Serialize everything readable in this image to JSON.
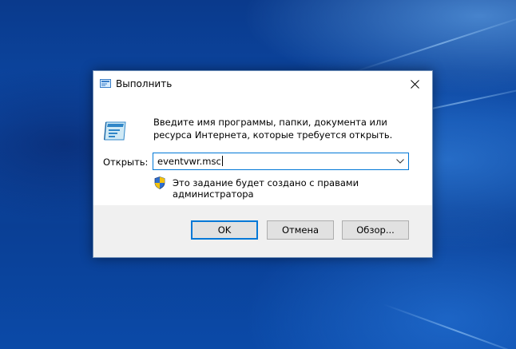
{
  "dialog": {
    "title": "Выполнить",
    "close_glyph": "✕",
    "description": "Введите имя программы, папки, документа или ресурса Интернета, которые требуется открыть.",
    "open_label": "Открыть:",
    "open_value": "eventvwr.msc",
    "admin_note": "Это задание будет создано с правами администратора",
    "buttons": {
      "ok": "OK",
      "cancel": "Отмена",
      "browse": "Обзор..."
    }
  },
  "colors": {
    "accent": "#0078d7",
    "footer_bg": "#f0f0f0",
    "desktop_blue": "#0c49a6"
  },
  "icons": {
    "app": "run-icon",
    "close": "close-icon",
    "dropdown": "chevron-down-icon",
    "uac": "shield-icon"
  }
}
